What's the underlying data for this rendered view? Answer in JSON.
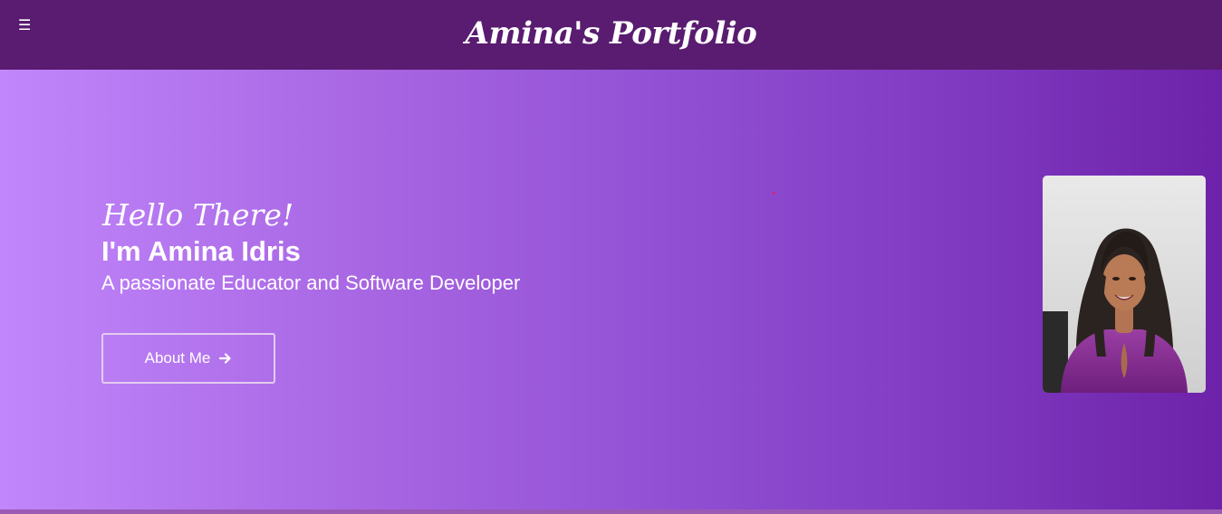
{
  "header": {
    "menu_icon": "hamburger-icon",
    "menu_glyph": "☰",
    "brand": "Amina's Portfolio"
  },
  "hero": {
    "greeting": "Hello There!",
    "name": "I'm Amina Idris",
    "tagline": "A passionate Educator and Software Developer",
    "cta_label": "About Me",
    "cta_icon": "arrow-right-icon",
    "portrait_icon": "profile-photo"
  },
  "colors": {
    "header_bg": "#591c70",
    "hero_gradient_start": "#c186fb",
    "hero_gradient_end": "#6d22a9",
    "text": "#ffffff",
    "button_border": "#e3ccef"
  }
}
